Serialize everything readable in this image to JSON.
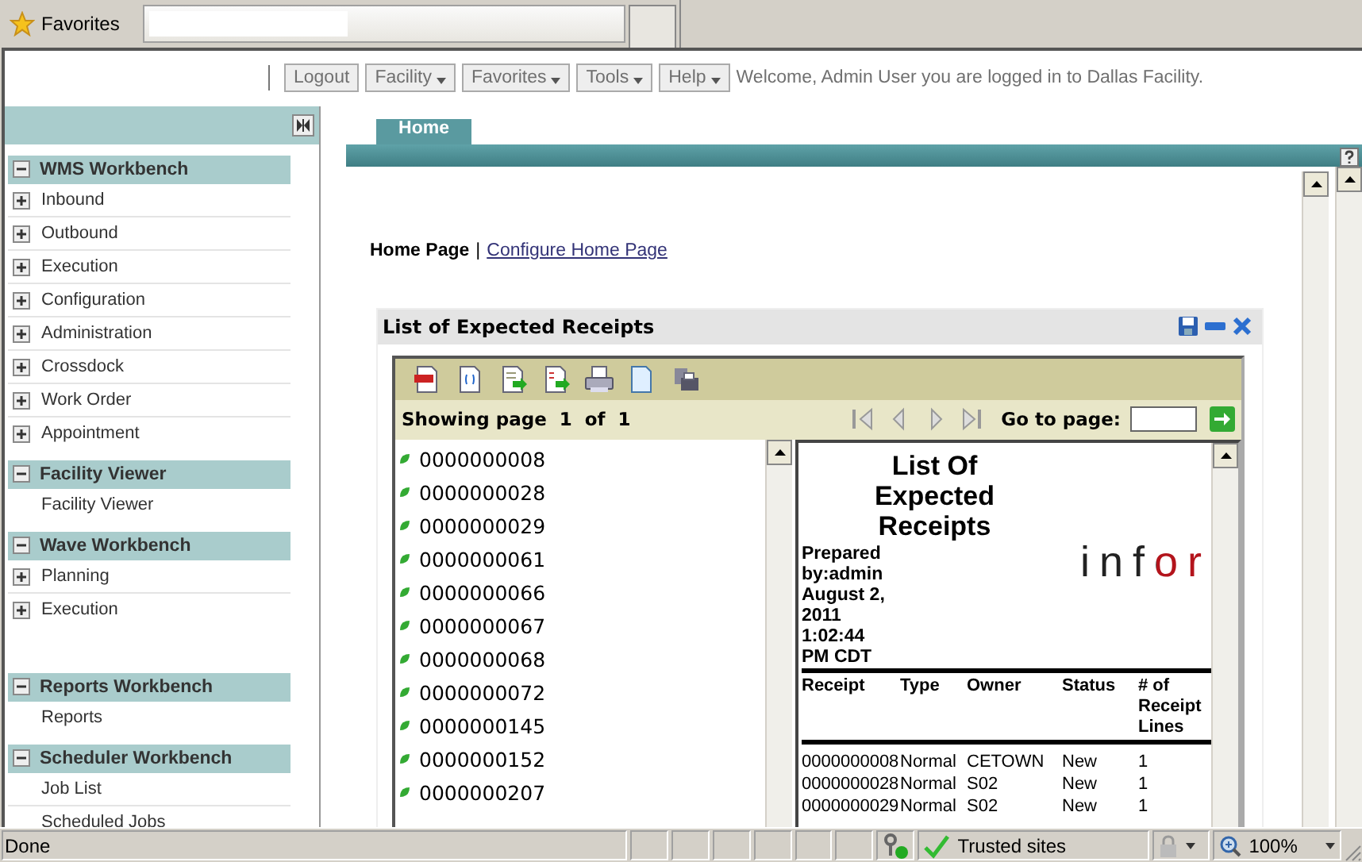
{
  "browser_bar": {
    "favorites_label": "Favorites"
  },
  "toolbar": {
    "buttons": [
      {
        "label": "Logout",
        "kind": "button"
      },
      {
        "label": "Facility",
        "kind": "menu"
      },
      {
        "label": "Favorites",
        "kind": "menu"
      },
      {
        "label": "Tools",
        "kind": "menu"
      },
      {
        "label": "Help",
        "kind": "menu"
      }
    ],
    "welcome": "Welcome, Admin User you are logged in to Dallas Facility."
  },
  "sidebar": {
    "sections": [
      {
        "title": "WMS Workbench",
        "expanded": true,
        "items": [
          {
            "label": "Inbound",
            "kind": "folder"
          },
          {
            "label": "Outbound",
            "kind": "folder"
          },
          {
            "label": "Execution",
            "kind": "folder"
          },
          {
            "label": "Configuration",
            "kind": "folder"
          },
          {
            "label": "Administration",
            "kind": "folder"
          },
          {
            "label": "Crossdock",
            "kind": "folder"
          },
          {
            "label": "Work Order",
            "kind": "folder"
          },
          {
            "label": "Appointment",
            "kind": "folder"
          }
        ]
      },
      {
        "title": "Facility Viewer",
        "expanded": true,
        "items": [
          {
            "label": "Facility Viewer",
            "kind": "link"
          }
        ]
      },
      {
        "title": "Wave Workbench",
        "expanded": true,
        "items": [
          {
            "label": "Planning",
            "kind": "folder"
          },
          {
            "label": "Execution",
            "kind": "folder"
          }
        ]
      },
      {
        "title": "Reports Workbench",
        "expanded": true,
        "items": [
          {
            "label": "Reports",
            "kind": "link"
          }
        ]
      },
      {
        "title": "Scheduler Workbench",
        "expanded": true,
        "items": [
          {
            "label": "Job List",
            "kind": "link"
          },
          {
            "label": "Scheduled Jobs",
            "kind": "link"
          }
        ]
      }
    ]
  },
  "tabs": [
    {
      "label": "Home",
      "selected": true
    }
  ],
  "breadcrumb": {
    "current": "Home Page",
    "separator": "|",
    "link": "Configure Home Page"
  },
  "portlet": {
    "title": "List of Expected Receipts",
    "viewer": {
      "page_status": {
        "label": "Showing page",
        "page": "1",
        "of": "of",
        "total": "1"
      },
      "goto_label": "Go to page:",
      "toc": [
        "0000000008",
        "0000000028",
        "0000000029",
        "0000000061",
        "0000000066",
        "0000000067",
        "0000000068",
        "0000000072",
        "0000000145",
        "0000000152",
        "0000000207"
      ],
      "report": {
        "title": "List Of Expected Receipts",
        "prepared": "Prepared by:admin August 2, 2011 1:02:44 PM CDT",
        "logo": "infor",
        "columns": [
          "Receipt",
          "Type",
          "Owner",
          "Status",
          "# of Receipt Lines"
        ],
        "rows": [
          [
            "0000000008",
            "Normal",
            "CETOWN",
            "New",
            "1"
          ],
          [
            "0000000028",
            "Normal",
            "S02",
            "New",
            "1"
          ],
          [
            "0000000029",
            "Normal",
            "S02",
            "New",
            "1"
          ]
        ]
      }
    }
  },
  "status_bar": {
    "text": "Done",
    "zone": "Trusted sites",
    "zoom": "100%"
  }
}
